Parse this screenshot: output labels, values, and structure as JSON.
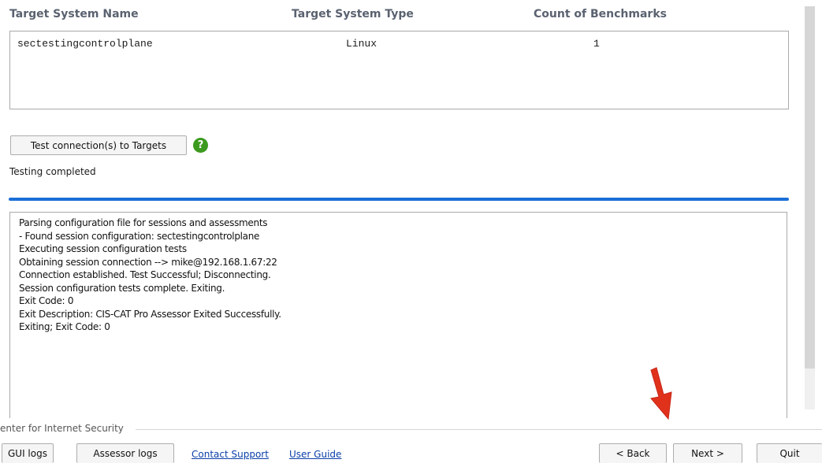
{
  "targets_table": {
    "headers": [
      "Target System Name",
      "Target System Type",
      "Count of Benchmarks"
    ],
    "rows": [
      {
        "name": "sectestingcontrolplane",
        "type": "Linux",
        "count": "1"
      }
    ]
  },
  "test_button_label": "Test connection(s) to Targets",
  "help_icon_glyph": "?",
  "status_text": "Testing completed",
  "progress": 1.0,
  "log_lines": [
    "Parsing configuration file for sessions and assessments",
    "- Found session configuration: sectestingcontrolplane",
    "Executing session configuration tests",
    "Obtaining session connection --> mike@192.168.1.67:22",
    "Connection established.  Test Successful; Disconnecting.",
    "Session configuration tests complete.  Exiting.",
    "Exit Code: 0",
    "Exit Description: CIS-CAT Pro Assessor Exited Successfully.",
    "Exiting; Exit Code: 0"
  ],
  "footer": {
    "group_label": "enter for Internet Security",
    "gui_logs": "GUI logs",
    "assessor_logs": "Assessor logs",
    "contact_support": "Contact Support",
    "user_guide": "User Guide",
    "back": "< Back",
    "next": "Next >",
    "quit": "Quit"
  },
  "colors": {
    "accent": "#1a6fd6",
    "help_green": "#3c9a1e",
    "arrow_red": "#e0321b"
  }
}
